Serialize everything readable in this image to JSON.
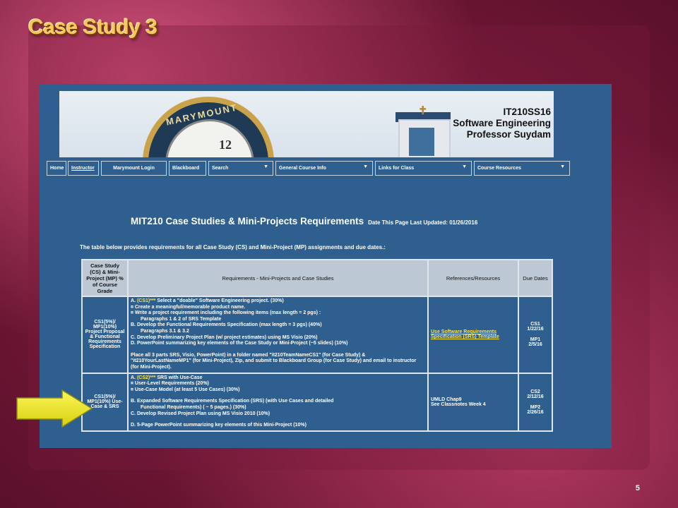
{
  "slide": {
    "title": "Case Study 3",
    "page_number": "5"
  },
  "colors": {
    "title_gold": "#f6c75a",
    "site_blue": "#2e5f8e",
    "highlight_yellow": "#ffe34a",
    "arrow_yellow": "#f2ee1c"
  },
  "banner": {
    "clock_text": "MARYMOUNT",
    "clock_number": "12",
    "course_code": "IT210SS16",
    "course_name": "Software Engineering",
    "professor": "Professor Suydam"
  },
  "nav": {
    "home": "Home",
    "instructor": "Instructor",
    "marymount_login": "Marymount Login",
    "blackboard": "Blackboard",
    "search": "Search",
    "general_course_info": "General Course Info",
    "links_for_class": "Links for Class",
    "course_resources": "Course Resources",
    "caret": "▼"
  },
  "page": {
    "heading": "MIT210 Case Studies & Mini-Projects Requirements",
    "last_updated": "Date This Page Last Updated:  01/26/2016",
    "intro": "The table below provides requirements for all Case Study (CS) and Mini-Project (MP) assignments and due dates.:"
  },
  "table": {
    "headers": {
      "col1": "Case Study (CS) & Mini-Project (MP) % of Course Grade",
      "col2": "Requirements - Mini-Projects and Case Studies",
      "col3": "References/Resources",
      "col4": "Due Dates"
    },
    "row1": {
      "cs": "CS1(5%)/ MP1(10%) Project Proposal & Functional Requirements Specification",
      "a_prefix": "A. ",
      "a_tag": "(CS1)***",
      "a_text": " Select a \"doable\" Software Engineering project. (30%)",
      "b1": "¤ Create a meaningful/memorable product name.",
      "b2": "¤ Write a project requirement including the following items  (max length = 2 pgs) :",
      "b3": "Paragraphs 1 & 2 of SRS Template",
      "c1": "B. Develop the Functional Requirements Specification (max length = 3 pgs) (40%)",
      "c2": "Paragraphs 3.1 & 3.2",
      "d1": "C. Develop Preliminary Project Plan (w/ project estimates) using MS Visio (20%)",
      "e1": "D. PowerPoint summarizing key elements of the Case Study or Mini-Project (~5 slides) (10%)",
      "f1": "Place all 3 parts SRS, Visio, PowerPoint) in a folder named \"it210TeamNameCS1\" (for Case Study) & \"it210YourLastNameMP1\" (for Mini-Project), Zip, and submit to Blackboard Group (for Case Study) and email to instructor (for Mini-Project).",
      "ref_link": "Use Software Requirements Specification (SRS) Template",
      "due1": "CS1",
      "due2": "1/22/16",
      "due3": "MP1",
      "due4": "2/5/16"
    },
    "row2": {
      "cs": "CS1(5%)/ MP1(10%) Use-Case & SRS",
      "a_prefix": "A. ",
      "a_tag": "(CS2)***",
      "a_text": " SRS with Use-Case",
      "b1": "¤ User-Level Requirements (20%)",
      "b2": "¤ Use-Case Model (at least 5 Use Cases) (30%)",
      "c1": "B. Expanded Software Requirements Specification  (SRS)  (with Use Cases and detailed",
      "c2": "Functional Requirements)  ( ~ 5 pages.) (30%)",
      "d1": "C. Develop Revised Project Plan using MS Visio 2010 (10%)",
      "e1": "D. 5-Page PowerPoint summarizing key elements of this Mini-Project (10%)",
      "ref1": "UMLD Chap9",
      "ref2": "See Classnotes Week 4",
      "due1": "CS2",
      "due2": "2/12/16",
      "due3": "MP2",
      "due4": "2/26/16"
    }
  }
}
